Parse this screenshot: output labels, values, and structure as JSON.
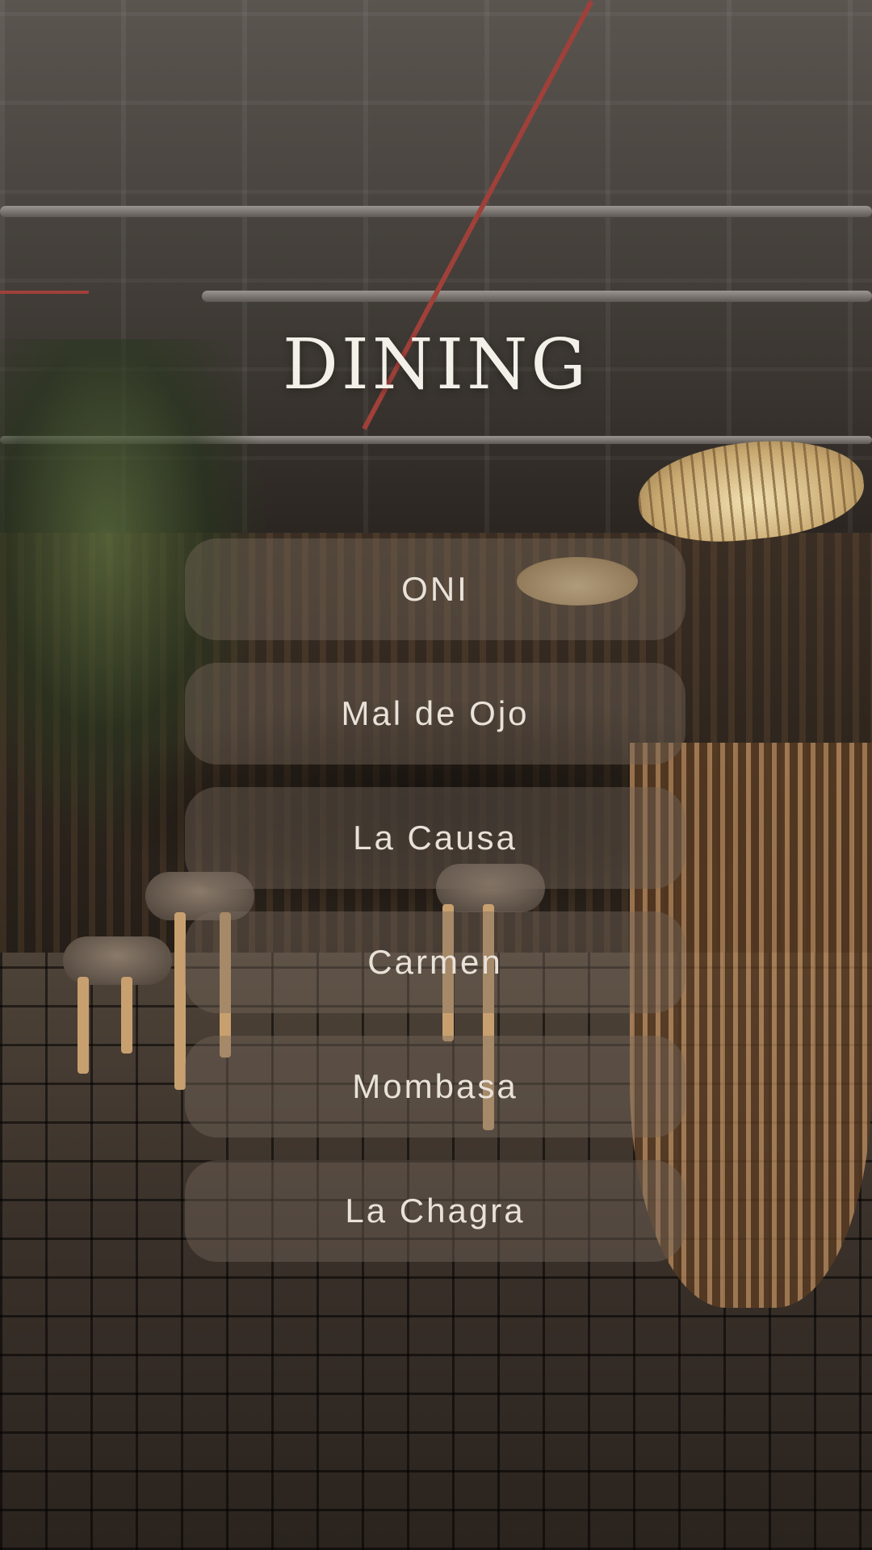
{
  "page": {
    "title": "DINING"
  },
  "menu": {
    "items": [
      {
        "label": "ONI"
      },
      {
        "label": "Mal de Ojo"
      },
      {
        "label": "La Causa"
      },
      {
        "label": "Carmen"
      },
      {
        "label": "Mombasa"
      },
      {
        "label": "La Chagra"
      }
    ]
  },
  "colors": {
    "button_fill": "#786a5d",
    "text": "#e9e2d9",
    "title": "#f3efe9"
  }
}
